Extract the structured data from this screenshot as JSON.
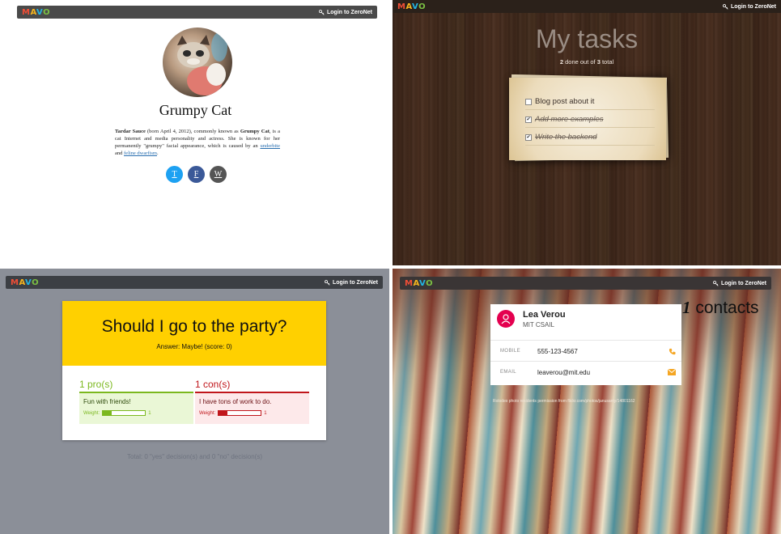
{
  "common": {
    "logo": [
      "M",
      "A",
      "V",
      "O"
    ],
    "login_label": "Login to ZeroNet"
  },
  "profile": {
    "name": "Grumpy Cat",
    "bio": {
      "name_bold": "Tardar Sauce",
      "text1": " (born April 4, 2012), commonly known as ",
      "alias_bold": "Grumpy Cat",
      "text2": ", is a cat Internet and media personality and actress. She is known for her permanently \"grumpy\" facial appearance, which is caused by an ",
      "link1": "underbite",
      "text3": " and ",
      "link2": "feline dwarfism",
      "text4": "."
    },
    "social": [
      {
        "label": "T",
        "color": "#1da1f2"
      },
      {
        "label": "F",
        "color": "#3b5998"
      },
      {
        "label": "W",
        "color": "#555555"
      }
    ]
  },
  "tasks": {
    "title": "My tasks",
    "done_count": "2",
    "done_mid": " done out of ",
    "total_count": "3",
    "done_suffix": " total",
    "items": [
      {
        "text": "Blog post about it",
        "done": false
      },
      {
        "text": "Add more examples",
        "done": true
      },
      {
        "text": "Write the backend",
        "done": true
      }
    ]
  },
  "decision": {
    "question": "Should I go to the party?",
    "answer": "Answer: Maybe! (score: 0)",
    "pros_header": "1 pro(s)",
    "cons_header": "1 con(s)",
    "pro_item": "Fun with friends!",
    "con_item": "I have tons of work to do.",
    "weight_label": "Weight:",
    "pro_weight": "1",
    "con_weight": "1",
    "pro_weight_fraction": 0.2,
    "con_weight_fraction": 0.2,
    "total": "Total: 0 \"yes\" decision(s) and 0 \"no\" decision(s)",
    "colors": {
      "yellow": "#ffd000",
      "pro": "#7bb81e",
      "con": "#c0161b"
    }
  },
  "contacts": {
    "name": "Lea Verou",
    "org": "MIT CSAIL",
    "mobile_label": "MOBILE",
    "mobile": "555-123-4567",
    "email_label": "EMAIL",
    "email": "leaverou@mit.edu",
    "count_num": "1",
    "count_word": " contacts",
    "credit": "Rolodex photo residents permission from flickr.com/photos/janusanty/14801162",
    "accent": "#f5a623"
  }
}
